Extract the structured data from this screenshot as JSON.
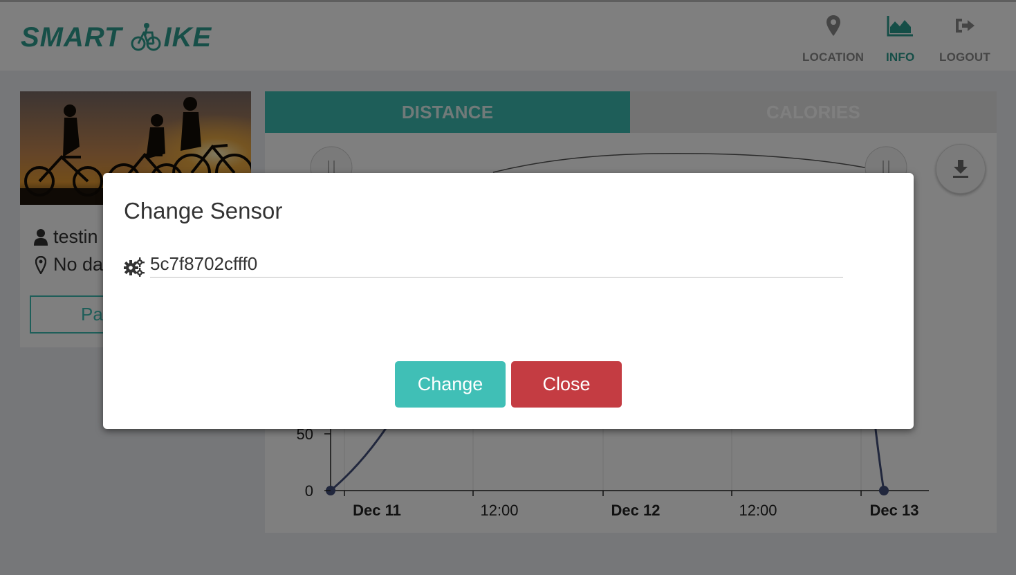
{
  "header": {
    "logo": {
      "left": "SMART",
      "right": "IKE"
    },
    "nav": [
      {
        "label": "LOCATION",
        "icon": "map-pin-icon"
      },
      {
        "label": "INFO",
        "icon": "area-chart-icon",
        "active": true
      },
      {
        "label": "LOGOUT",
        "icon": "sign-out-icon"
      }
    ]
  },
  "profile": {
    "username": "testin",
    "location": "No da",
    "button_label": "Pa"
  },
  "tabs": [
    {
      "label": "DISTANCE",
      "active": true
    },
    {
      "label": "CALORIES",
      "active": false
    }
  ],
  "chart_data": {
    "type": "line",
    "x": [
      "Dec 11",
      "Dec 13"
    ],
    "y_ticks_visible": [
      0,
      50
    ],
    "x_tick_labels": [
      "Dec 11",
      "12:00",
      "Dec 12",
      "12:00",
      "Dec 13"
    ],
    "series": [
      {
        "values_visible": [
          0,
          0
        ]
      }
    ],
    "line_color": "#434f7a",
    "grid": true
  },
  "modal": {
    "title": "Change Sensor",
    "sensor_value": "5c7f8702cfff0",
    "change_label": "Change",
    "close_label": "Close"
  },
  "colors": {
    "brand": "#2e9e90",
    "primary": "#40bfb6",
    "danger": "#c43c42"
  }
}
